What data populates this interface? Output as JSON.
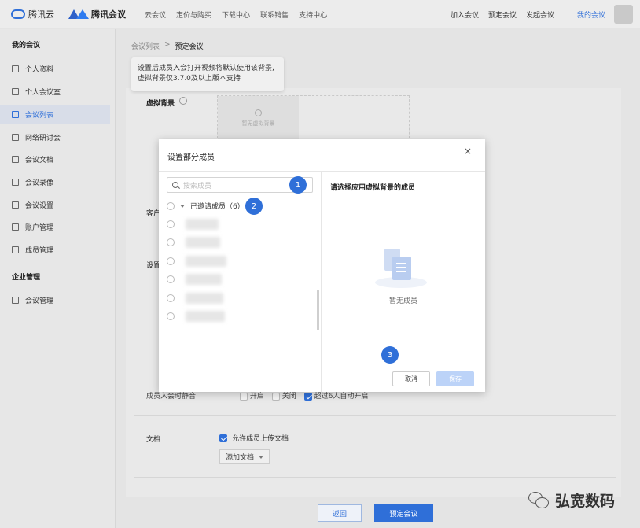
{
  "header": {
    "brand1": "腾讯云",
    "brand2": "腾讯会议",
    "nav": [
      "云会议",
      "定价与购买",
      "下载中心",
      "联系销售",
      "支持中心"
    ],
    "actions": [
      "加入会议",
      "预定会议",
      "发起会议"
    ],
    "my_meetings": "我的会议"
  },
  "sidebar": {
    "section1": "我的会议",
    "items": [
      {
        "label": "个人资料",
        "icon": "user-icon"
      },
      {
        "label": "个人会议室",
        "icon": "room-icon"
      },
      {
        "label": "会议列表",
        "icon": "list-icon",
        "active": true
      },
      {
        "label": "网络研讨会",
        "icon": "webinar-icon"
      },
      {
        "label": "会议文档",
        "icon": "document-icon"
      },
      {
        "label": "会议录像",
        "icon": "video-icon"
      },
      {
        "label": "会议设置",
        "icon": "settings-icon"
      },
      {
        "label": "账户管理",
        "icon": "account-icon"
      },
      {
        "label": "成员管理",
        "icon": "members-icon"
      }
    ],
    "section2": "企业管理",
    "items2": [
      {
        "label": "会议管理",
        "icon": "grid-icon"
      }
    ]
  },
  "breadcrumb": {
    "parent": "会议列表",
    "sep": ">",
    "current": "预定会议"
  },
  "tooltip": {
    "line1": "设置后成员入会打开视频将默认使用该背景,",
    "line2": "虚拟背景仅3.7.0及以上版本支持"
  },
  "form": {
    "virtual_bg_label": "虚拟背景",
    "no_bg_text": "暂无虚拟背景",
    "client_label_partial": "客户",
    "settings_label_partial": "设置",
    "mute_label": "成员入会时静音",
    "mute_options": [
      {
        "label": "开启",
        "checked": false
      },
      {
        "label": "关闭",
        "checked": false
      },
      {
        "label": "超过6人自动开启",
        "checked": true
      }
    ],
    "doc_label": "文档",
    "allow_upload": "允许成员上传文档",
    "add_doc": "添加文档"
  },
  "footer": {
    "back": "返回",
    "book": "预定会议"
  },
  "watermark": "弘宽数码",
  "modal": {
    "title": "设置部分成员",
    "close": "×",
    "search_placeholder": "搜索成员",
    "group_label": "已邀请成员（6）",
    "members_count": 6,
    "right_title": "请选择应用虚拟背景的成员",
    "empty_text": "暂无成员",
    "cancel": "取消",
    "save": "保存",
    "badges": [
      "1",
      "2",
      "3"
    ]
  },
  "colors": {
    "accent": "#2f6fd8",
    "badge": "#2f6fd8"
  }
}
